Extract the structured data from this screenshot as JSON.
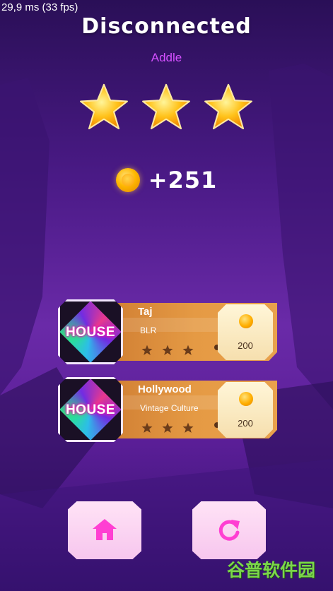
{
  "hud": {
    "fps_text": "29,9 ms (33 fps)"
  },
  "result": {
    "title": "Disconnected",
    "subtitle": "Addle",
    "stars_earned": 3,
    "stars_total": 3,
    "coin_reward": "+251"
  },
  "songs": [
    {
      "thumb_label": "HOUSE",
      "name": "Taj",
      "artist": "BLR",
      "price": "200",
      "rating_stars": 3
    },
    {
      "thumb_label": "HOUSE",
      "name": "Hollywood",
      "artist": "Vintage Culture",
      "price": "200",
      "rating_stars": 3
    }
  ],
  "buttons": {
    "home_icon": "home-icon",
    "replay_icon": "replay-icon"
  },
  "watermark": "谷普软件园",
  "colors": {
    "accent_pink": "#d450ff",
    "card_orange": "#e59a44",
    "star_gold": "#ffc21a",
    "button_icon": "#ff3fd2"
  }
}
